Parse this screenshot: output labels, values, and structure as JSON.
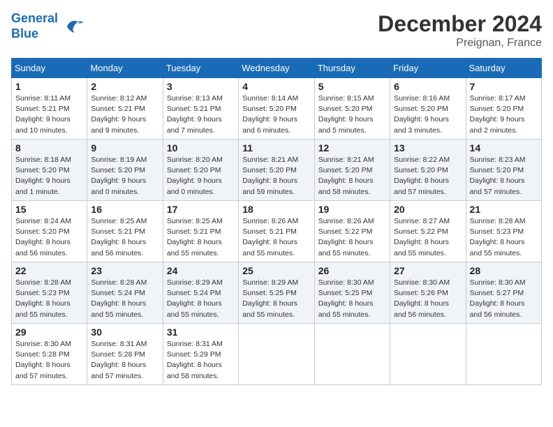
{
  "header": {
    "logo_line1": "General",
    "logo_line2": "Blue",
    "month": "December 2024",
    "location": "Preignan, France"
  },
  "days_of_week": [
    "Sunday",
    "Monday",
    "Tuesday",
    "Wednesday",
    "Thursday",
    "Friday",
    "Saturday"
  ],
  "weeks": [
    [
      {
        "day": 1,
        "info": "Sunrise: 8:11 AM\nSunset: 5:21 PM\nDaylight: 9 hours\nand 10 minutes."
      },
      {
        "day": 2,
        "info": "Sunrise: 8:12 AM\nSunset: 5:21 PM\nDaylight: 9 hours\nand 9 minutes."
      },
      {
        "day": 3,
        "info": "Sunrise: 8:13 AM\nSunset: 5:21 PM\nDaylight: 9 hours\nand 7 minutes."
      },
      {
        "day": 4,
        "info": "Sunrise: 8:14 AM\nSunset: 5:20 PM\nDaylight: 9 hours\nand 6 minutes."
      },
      {
        "day": 5,
        "info": "Sunrise: 8:15 AM\nSunset: 5:20 PM\nDaylight: 9 hours\nand 5 minutes."
      },
      {
        "day": 6,
        "info": "Sunrise: 8:16 AM\nSunset: 5:20 PM\nDaylight: 9 hours\nand 3 minutes."
      },
      {
        "day": 7,
        "info": "Sunrise: 8:17 AM\nSunset: 5:20 PM\nDaylight: 9 hours\nand 2 minutes."
      }
    ],
    [
      {
        "day": 8,
        "info": "Sunrise: 8:18 AM\nSunset: 5:20 PM\nDaylight: 9 hours\nand 1 minute."
      },
      {
        "day": 9,
        "info": "Sunrise: 8:19 AM\nSunset: 5:20 PM\nDaylight: 9 hours\nand 0 minutes."
      },
      {
        "day": 10,
        "info": "Sunrise: 8:20 AM\nSunset: 5:20 PM\nDaylight: 9 hours\nand 0 minutes."
      },
      {
        "day": 11,
        "info": "Sunrise: 8:21 AM\nSunset: 5:20 PM\nDaylight: 8 hours\nand 59 minutes."
      },
      {
        "day": 12,
        "info": "Sunrise: 8:21 AM\nSunset: 5:20 PM\nDaylight: 8 hours\nand 58 minutes."
      },
      {
        "day": 13,
        "info": "Sunrise: 8:22 AM\nSunset: 5:20 PM\nDaylight: 8 hours\nand 57 minutes."
      },
      {
        "day": 14,
        "info": "Sunrise: 8:23 AM\nSunset: 5:20 PM\nDaylight: 8 hours\nand 57 minutes."
      }
    ],
    [
      {
        "day": 15,
        "info": "Sunrise: 8:24 AM\nSunset: 5:20 PM\nDaylight: 8 hours\nand 56 minutes."
      },
      {
        "day": 16,
        "info": "Sunrise: 8:25 AM\nSunset: 5:21 PM\nDaylight: 8 hours\nand 56 minutes."
      },
      {
        "day": 17,
        "info": "Sunrise: 8:25 AM\nSunset: 5:21 PM\nDaylight: 8 hours\nand 55 minutes."
      },
      {
        "day": 18,
        "info": "Sunrise: 8:26 AM\nSunset: 5:21 PM\nDaylight: 8 hours\nand 55 minutes."
      },
      {
        "day": 19,
        "info": "Sunrise: 8:26 AM\nSunset: 5:22 PM\nDaylight: 8 hours\nand 55 minutes."
      },
      {
        "day": 20,
        "info": "Sunrise: 8:27 AM\nSunset: 5:22 PM\nDaylight: 8 hours\nand 55 minutes."
      },
      {
        "day": 21,
        "info": "Sunrise: 8:28 AM\nSunset: 5:23 PM\nDaylight: 8 hours\nand 55 minutes."
      }
    ],
    [
      {
        "day": 22,
        "info": "Sunrise: 8:28 AM\nSunset: 5:23 PM\nDaylight: 8 hours\nand 55 minutes."
      },
      {
        "day": 23,
        "info": "Sunrise: 8:28 AM\nSunset: 5:24 PM\nDaylight: 8 hours\nand 55 minutes."
      },
      {
        "day": 24,
        "info": "Sunrise: 8:29 AM\nSunset: 5:24 PM\nDaylight: 8 hours\nand 55 minutes."
      },
      {
        "day": 25,
        "info": "Sunrise: 8:29 AM\nSunset: 5:25 PM\nDaylight: 8 hours\nand 55 minutes."
      },
      {
        "day": 26,
        "info": "Sunrise: 8:30 AM\nSunset: 5:25 PM\nDaylight: 8 hours\nand 55 minutes."
      },
      {
        "day": 27,
        "info": "Sunrise: 8:30 AM\nSunset: 5:26 PM\nDaylight: 8 hours\nand 56 minutes."
      },
      {
        "day": 28,
        "info": "Sunrise: 8:30 AM\nSunset: 5:27 PM\nDaylight: 8 hours\nand 56 minutes."
      }
    ],
    [
      {
        "day": 29,
        "info": "Sunrise: 8:30 AM\nSunset: 5:28 PM\nDaylight: 8 hours\nand 57 minutes."
      },
      {
        "day": 30,
        "info": "Sunrise: 8:31 AM\nSunset: 5:28 PM\nDaylight: 8 hours\nand 57 minutes."
      },
      {
        "day": 31,
        "info": "Sunrise: 8:31 AM\nSunset: 5:29 PM\nDaylight: 8 hours\nand 58 minutes."
      },
      null,
      null,
      null,
      null
    ]
  ]
}
